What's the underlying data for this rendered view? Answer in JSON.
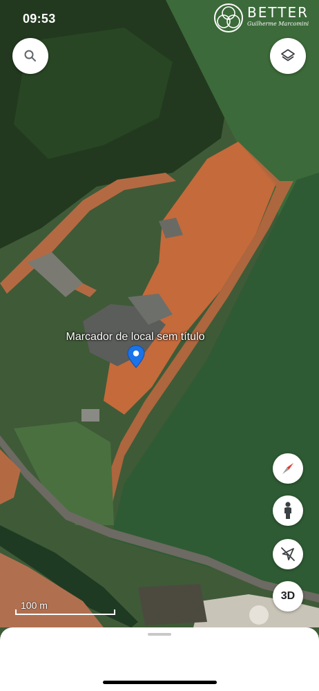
{
  "status_bar": {
    "time": "09:53"
  },
  "watermark": {
    "brand": "BETTER",
    "subtitle": "Guilherme Marcomini"
  },
  "map": {
    "view": "satellite",
    "marker": {
      "label": "Marcador de local sem título",
      "color": "#1a73e8"
    },
    "scale": {
      "label": "100 m"
    }
  },
  "controls": {
    "search": "search-icon",
    "layers": "layers-icon",
    "compass": "compass-icon",
    "street_view": "pegman-icon",
    "location": "location-off-icon",
    "three_d_label": "3D"
  },
  "colors": {
    "field": "#2f5a34",
    "dirt": "#c86a3e",
    "trees": "#1f3a22",
    "road": "#6c6a62"
  }
}
